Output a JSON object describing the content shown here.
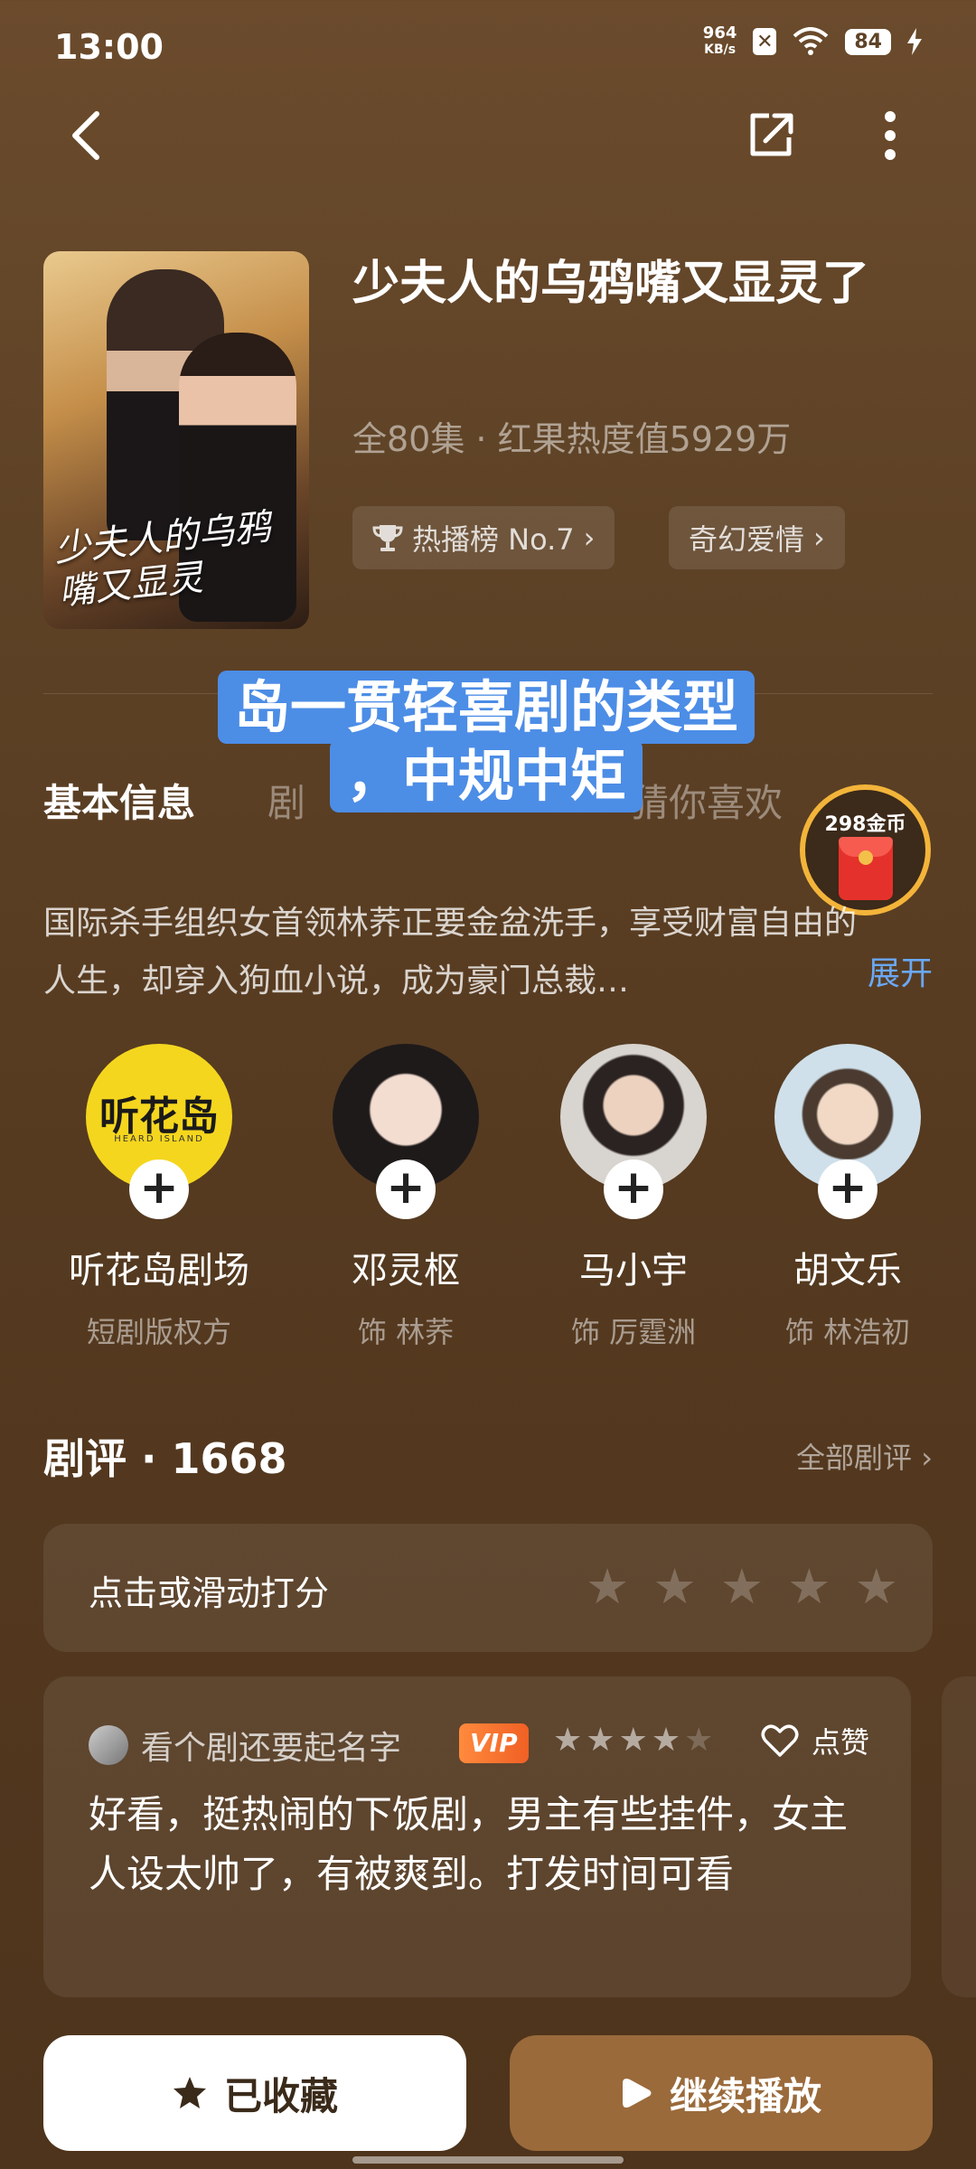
{
  "status_bar": {
    "time": "13:00",
    "net_speed_value": "964",
    "net_speed_unit": "KB/s",
    "battery": "84"
  },
  "drama": {
    "title": "少夫人的乌鸦嘴又显灵了",
    "meta": "全80集 · 红果热度值5929万",
    "poster_title": "少夫人的乌鸦嘴又显灵",
    "tags": [
      {
        "label": "热播榜 No.7",
        "icon": "trophy-icon"
      },
      {
        "label": "奇幻爱情",
        "icon": ""
      }
    ]
  },
  "overlay_caption": {
    "line1": "岛一贯轻喜剧的类型",
    "line2": "，中规中矩"
  },
  "tabs": [
    {
      "label": "基本信息",
      "active": true
    },
    {
      "label": "剧",
      "active": false
    },
    {
      "label": "猜你喜欢",
      "active": false
    }
  ],
  "coin_badge": {
    "label": "298金币"
  },
  "synopsis": {
    "text": "国际杀手组织女首领林荞正要金盆洗手，享受财富自由的人生，却穿入狗血小说，成为豪门总裁…",
    "expand_label": "展开"
  },
  "cast": [
    {
      "name": "听花岛剧场",
      "role": "短剧版权方",
      "logo_text": "听花岛",
      "logo_sub": "HEARD ISLAND"
    },
    {
      "name": "邓灵枢",
      "role": "饰 林荞"
    },
    {
      "name": "马小宇",
      "role": "饰 厉霆洲"
    },
    {
      "name": "胡文乐",
      "role": "饰 林浩初"
    }
  ],
  "reviews": {
    "section_label": "剧评 · 1668",
    "all_label": "全部剧评",
    "rate_prompt": "点击或滑动打分",
    "items": [
      {
        "user": "看个剧还要起名字",
        "badge": "VIP",
        "rating": 4,
        "like_label": "点赞",
        "text": "好看，挺热闹的下饭剧，男主有些挂件，女主人设太帅了，有被爽到。打发时间可看"
      }
    ]
  },
  "actions": {
    "favorite_label": "已收藏",
    "play_label": "继续播放"
  },
  "colors": {
    "background": "#5e4226",
    "link": "#6aa8f5",
    "play_button": "#9a6a3b",
    "caption_bg": "#4c8de6",
    "vip": "#f06024"
  }
}
